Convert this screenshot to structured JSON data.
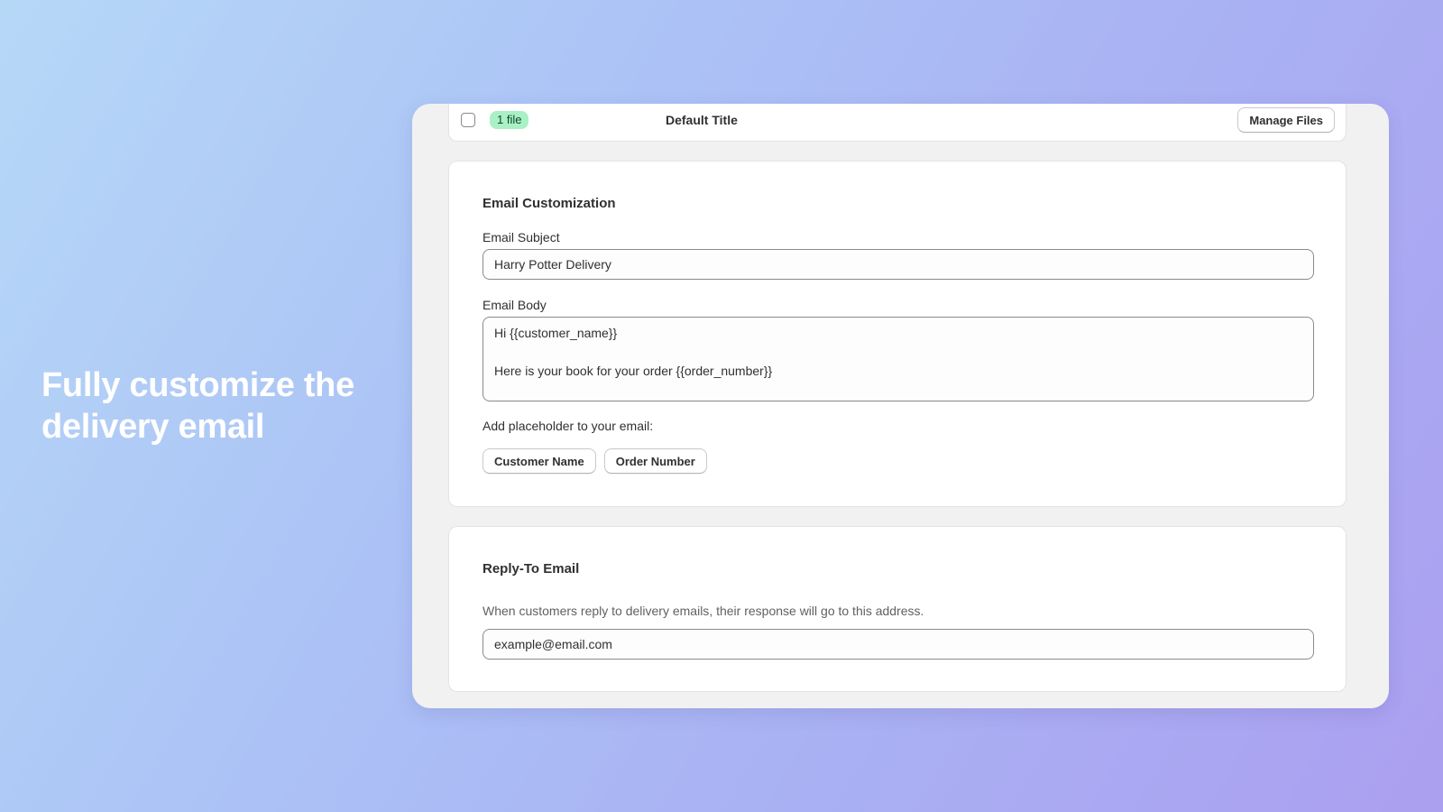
{
  "hero": {
    "line1": "Fully customize the",
    "line2": "delivery email"
  },
  "file_row": {
    "badge": "1 file",
    "title": "Default Title",
    "manage_button": "Manage Files"
  },
  "email_customization": {
    "title": "Email Customization",
    "subject_label": "Email Subject",
    "subject_value": "Harry Potter Delivery",
    "body_label": "Email Body",
    "body_value": "Hi {{customer_name}}\n\nHere is your book for your order {{order_number}}",
    "placeholder_label": "Add placeholder to your email:",
    "placeholder_buttons": [
      "Customer Name",
      "Order Number"
    ]
  },
  "reply_to": {
    "title": "Reply-To Email",
    "help": "When customers reply to delivery emails, their response will go to this address.",
    "value": "example@email.com"
  },
  "colors": {
    "badge_bg": "#a9f0c6",
    "background_start": "#b6d8f7",
    "background_end": "#ab9ff0"
  },
  "icons": {
    "checkbox": "checkbox-unchecked-icon"
  }
}
